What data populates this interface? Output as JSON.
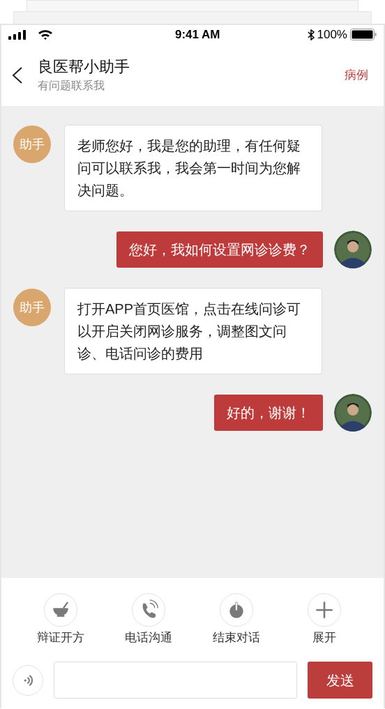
{
  "status_bar": {
    "time": "9:41 AM",
    "battery": "100%"
  },
  "header": {
    "title": "良医帮小助手",
    "subtitle": "有问题联系我",
    "action": "病例"
  },
  "messages": [
    {
      "kind": "assistant",
      "avatar_label": "助手",
      "text": "老师您好，我是您的助理，有任何疑问可以联系我，我会第一时间为您解决问题。"
    },
    {
      "kind": "user",
      "text": "您好，我如何设置网诊诊费？"
    },
    {
      "kind": "assistant",
      "avatar_label": "助手",
      "text": "打开APP首页医馆，点击在线问诊可以开启关闭网诊服务，调整图文问诊、电话问诊的费用"
    },
    {
      "kind": "user",
      "text": "好的，谢谢！"
    }
  ],
  "actions": [
    {
      "kind": "bowl",
      "label": "辩证开方"
    },
    {
      "kind": "phone",
      "label": "电话沟通"
    },
    {
      "kind": "power",
      "label": "结束对话"
    },
    {
      "kind": "plus",
      "label": "展开"
    }
  ],
  "composer": {
    "send": "发送"
  }
}
